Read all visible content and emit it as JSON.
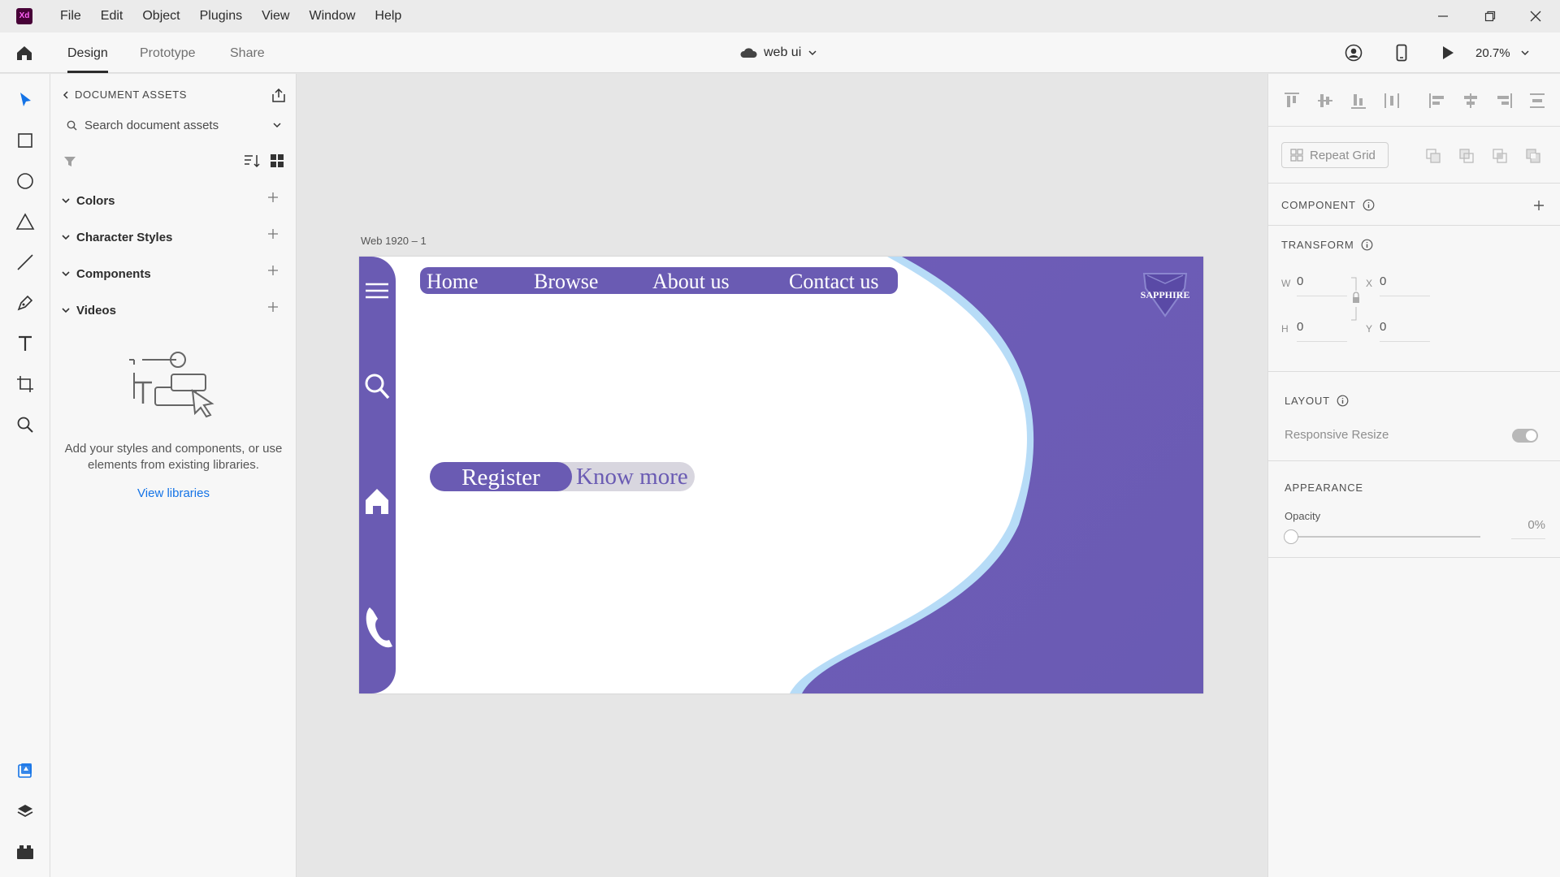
{
  "app": {
    "logo_text": "Xd",
    "menu": [
      "File",
      "Edit",
      "Object",
      "Plugins",
      "View",
      "Window",
      "Help"
    ]
  },
  "toolbar": {
    "tabs": [
      "Design",
      "Prototype",
      "Share"
    ],
    "active_tab": "Design",
    "document_title": "web ui",
    "zoom": "20.7%"
  },
  "tools": [
    "select-tool",
    "rectangle-tool",
    "ellipse-tool",
    "polygon-tool",
    "line-tool",
    "pen-tool",
    "text-tool",
    "artboard-tool",
    "zoom-tool"
  ],
  "assets_panel": {
    "header": "DOCUMENT ASSETS",
    "search_placeholder": "Search document assets",
    "sections": [
      "Colors",
      "Character Styles",
      "Components",
      "Videos"
    ],
    "empty_message": "Add your styles and components, or use elements from existing libraries.",
    "view_libraries_link": "View libraries"
  },
  "canvas": {
    "artboard_label": "Web 1920 – 1",
    "nav_links": [
      "Home",
      "Browse",
      "About us",
      "Contact us"
    ],
    "brand_text": "SAPPHIRE",
    "register_label": "Register",
    "know_more_label": "Know more",
    "accent_color": "#6a5bb3",
    "wave_edge_color": "#b7dcf7"
  },
  "inspector": {
    "repeat_grid_label": "Repeat Grid",
    "component_title": "COMPONENT",
    "transform_title": "TRANSFORM",
    "w_label": "W",
    "w_value": "0",
    "x_label": "X",
    "x_value": "0",
    "h_label": "H",
    "h_value": "0",
    "y_label": "Y",
    "y_value": "0",
    "layout_title": "LAYOUT",
    "responsive_resize_label": "Responsive Resize",
    "responsive_resize_on": true,
    "appearance_title": "APPEARANCE",
    "opacity_label": "Opacity",
    "opacity_value": "0%"
  }
}
